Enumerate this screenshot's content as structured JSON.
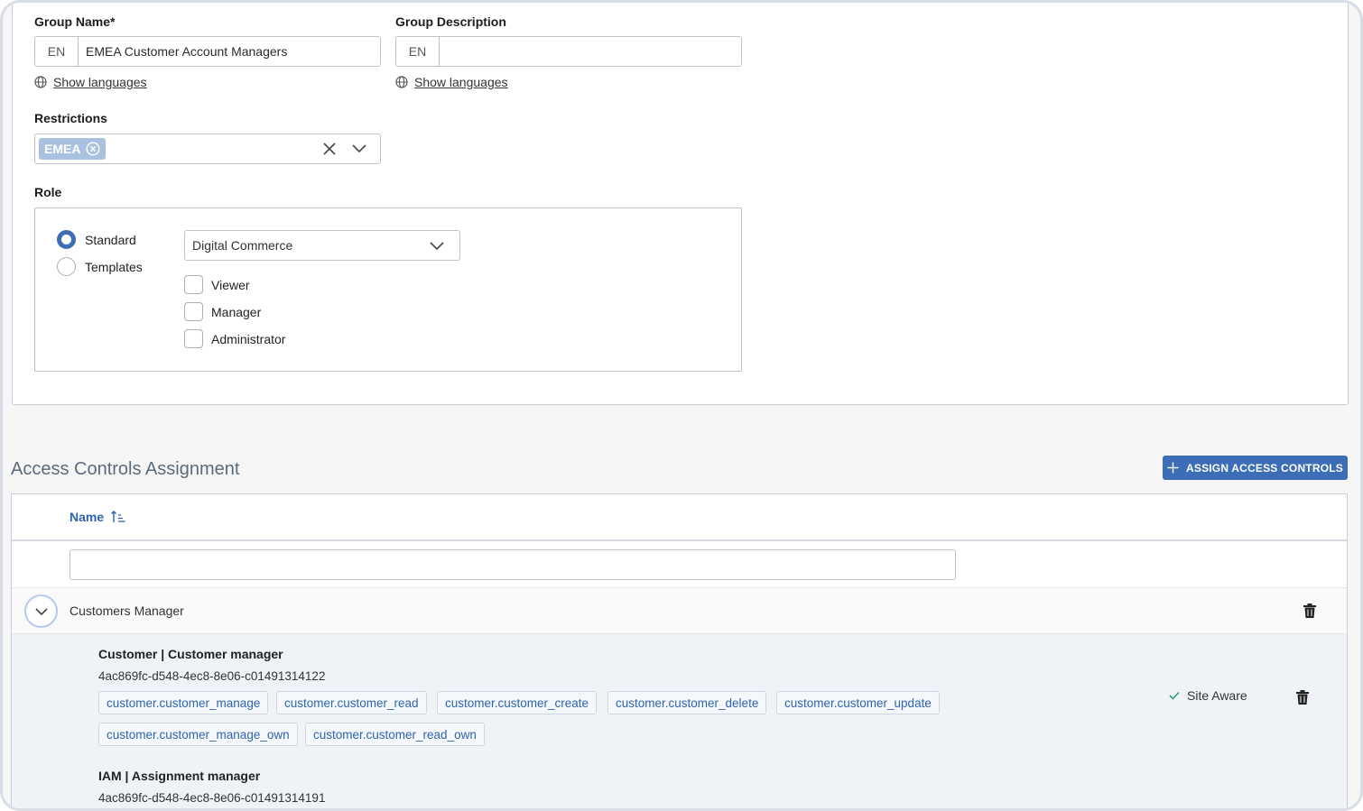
{
  "form": {
    "group_name": {
      "label": "Group Name*",
      "lang": "EN",
      "value": "EMEA Customer Account Managers",
      "show_languages": "Show languages"
    },
    "group_description": {
      "label": "Group Description",
      "lang": "EN",
      "value": "",
      "show_languages": "Show languages"
    },
    "restrictions": {
      "label": "Restrictions",
      "chips": [
        "EMEA"
      ]
    },
    "role": {
      "label": "Role",
      "options": [
        "Standard",
        "Templates"
      ],
      "selected_option": "Standard",
      "select_value": "Digital Commerce",
      "checkboxes": [
        "Viewer",
        "Manager",
        "Administrator"
      ]
    }
  },
  "access_controls": {
    "title": "Access Controls Assignment",
    "assign_button": "ASSIGN ACCESS CONTROLS",
    "column_name": "Name",
    "filter_value": "",
    "group": {
      "name": "Customers Manager",
      "items": [
        {
          "title": "Customer | Customer manager",
          "id": "4ac869fc-d548-4ec8-8e06-c01491314122",
          "permissions": [
            "customer.customer_manage",
            "customer.customer_read",
            "customer.customer_create",
            "customer.customer_delete",
            "customer.customer_update",
            "customer.customer_manage_own",
            "customer.customer_read_own"
          ],
          "site_aware": "Site Aware"
        },
        {
          "title": "IAM | Assignment manager",
          "id": "4ac869fc-d548-4ec8-8e06-c01491314191"
        }
      ]
    }
  },
  "colors": {
    "accent": "#3b6eb6",
    "chip": "#a9c2e0",
    "link": "#2f64ad",
    "success": "#2ba36f"
  }
}
